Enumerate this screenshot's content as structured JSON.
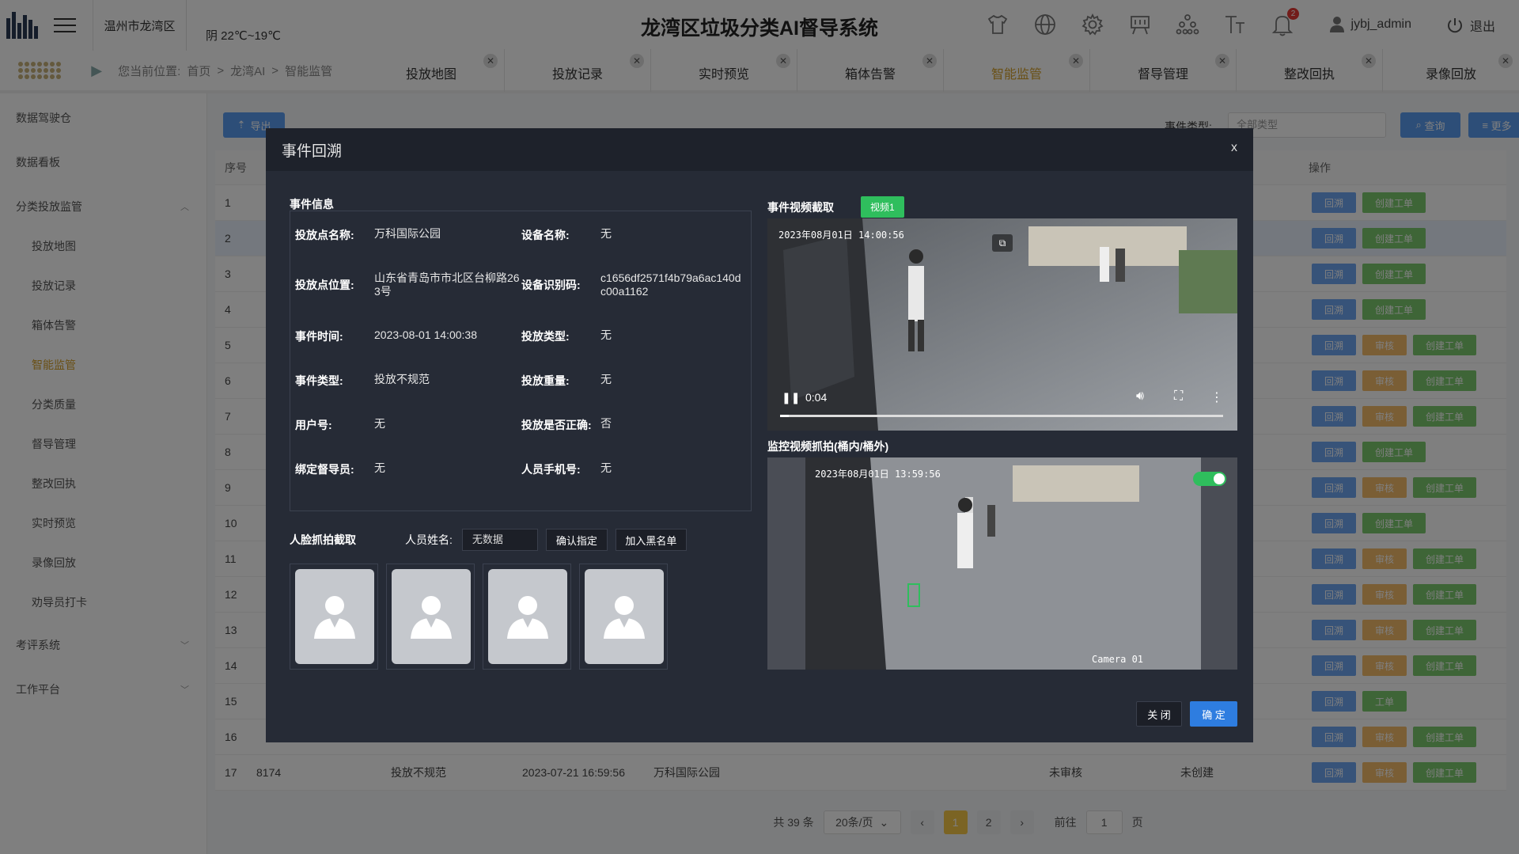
{
  "header": {
    "city": "温州市龙湾区",
    "weather": "阴 22℃~19℃",
    "title": "龙湾区垃圾分类AI督导系统",
    "icons": [
      "shirt-icon",
      "globe-icon",
      "gear-icon",
      "board-icon",
      "org-icon",
      "font-size-icon",
      "bell-icon"
    ],
    "bell_count": "2",
    "username": "jybj_admin",
    "logout": "退出"
  },
  "breadcrumb": {
    "prefix": "您当前位置:",
    "items": [
      "首页",
      "龙湾AI",
      "智能监管"
    ]
  },
  "tabs": [
    {
      "label": "投放地图"
    },
    {
      "label": "投放记录"
    },
    {
      "label": "实时预览"
    },
    {
      "label": "箱体告警"
    },
    {
      "label": "智能监管"
    },
    {
      "label": "督导管理"
    },
    {
      "label": "整改回执"
    },
    {
      "label": "录像回放"
    }
  ],
  "sidebar": {
    "top": [
      {
        "label": "数据驾驶仓"
      },
      {
        "label": "数据看板"
      }
    ],
    "group1": {
      "label": "分类投放监管"
    },
    "sub": [
      {
        "label": "投放地图"
      },
      {
        "label": "投放记录"
      },
      {
        "label": "箱体告警"
      },
      {
        "label": "智能监管"
      },
      {
        "label": "分类质量"
      },
      {
        "label": "督导管理"
      },
      {
        "label": "整改回执"
      },
      {
        "label": "实时预览"
      },
      {
        "label": "录像回放"
      },
      {
        "label": "劝导员打卡"
      }
    ],
    "group2": {
      "label": "考评系统"
    },
    "group3": {
      "label": "工作平台"
    }
  },
  "toolbar": {
    "export": "导出",
    "filter_label": "事件类型:",
    "filter_value": "全部类型",
    "query": "查询",
    "more": "更多"
  },
  "table": {
    "header_index": "序号",
    "header_ops": "操作",
    "rows": [
      {
        "idx": "1",
        "ops": [
          "回溯",
          "创建工单"
        ]
      },
      {
        "idx": "2",
        "ops": [
          "回溯",
          "创建工单"
        ]
      },
      {
        "idx": "3",
        "ops": [
          "回溯",
          "创建工单"
        ]
      },
      {
        "idx": "4",
        "ops": [
          "回溯",
          "创建工单"
        ]
      },
      {
        "idx": "5",
        "ops": [
          "回溯",
          "审核",
          "创建工单"
        ]
      },
      {
        "idx": "6",
        "ops": [
          "回溯",
          "审核",
          "创建工单"
        ]
      },
      {
        "idx": "7",
        "ops": [
          "回溯",
          "审核",
          "创建工单"
        ]
      },
      {
        "idx": "8",
        "ops": [
          "回溯",
          "创建工单"
        ]
      },
      {
        "idx": "9",
        "ops": [
          "回溯",
          "审核",
          "创建工单"
        ]
      },
      {
        "idx": "10",
        "ops": [
          "回溯",
          "创建工单"
        ]
      },
      {
        "idx": "11",
        "ops": [
          "回溯",
          "审核",
          "创建工单"
        ]
      },
      {
        "idx": "12",
        "ops": [
          "回溯",
          "审核",
          "创建工单"
        ]
      },
      {
        "idx": "13",
        "ops": [
          "回溯",
          "审核",
          "创建工单"
        ]
      },
      {
        "idx": "14",
        "ops": [
          "回溯",
          "审核",
          "创建工单"
        ]
      },
      {
        "idx": "15",
        "ops": [
          "回溯",
          "工单"
        ]
      },
      {
        "idx": "16",
        "ops": [
          "回溯",
          "审核",
          "创建工单"
        ]
      },
      {
        "idx": "17",
        "id": "8174",
        "type": "投放不规范",
        "time": "2023-07-21 16:59:56",
        "place": "万科国际公园",
        "audit": "未审核",
        "order": "未创建",
        "ops": [
          "回溯",
          "审核",
          "创建工单"
        ]
      }
    ]
  },
  "pager": {
    "total": "共 39 条",
    "size": "20条/页",
    "pages": [
      "1",
      "2"
    ],
    "goto_prefix": "前往",
    "goto_value": "1",
    "goto_suffix": "页"
  },
  "modal": {
    "title": "事件回溯",
    "close": "x",
    "info_title": "事件信息",
    "fields": {
      "place_name_k": "投放点名称:",
      "place_name_v": "万科国际公园",
      "device_name_k": "设备名称:",
      "device_name_v": "无",
      "place_loc_k": "投放点位置:",
      "place_loc_v": "山东省青岛市市北区台柳路263号",
      "device_id_k": "设备识别码:",
      "device_id_v": "c1656df2571f4b79a6ac140dc00a1162",
      "event_time_k": "事件时间:",
      "event_time_v": "2023-08-01 14:00:38",
      "drop_type_k": "投放类型:",
      "drop_type_v": "无",
      "event_type_k": "事件类型:",
      "event_type_v": "投放不规范",
      "weight_k": "投放重量:",
      "weight_v": "无",
      "user_no_k": "用户号:",
      "user_no_v": "无",
      "correct_k": "投放是否正确:",
      "correct_v": "否",
      "supervisor_k": "绑定督导员:",
      "supervisor_v": "无",
      "phone_k": "人员手机号:",
      "phone_v": "无"
    },
    "face_title": "人脸抓拍截取",
    "face_name_label": "人员姓名:",
    "face_name_value": "无数据",
    "confirm_btn": "确认指定",
    "blacklist_btn": "加入黑名单",
    "video_title": "事件视频截取",
    "video_tag": "视频1",
    "video_ts": "2023年08月01日  14:00:56",
    "video_time": "0:04",
    "video_progress": 0.02,
    "monitor_title": "监控视频抓拍(桶内/桶外)",
    "monitor_ts": "2023年08月01日  13:59:56",
    "camera_label": "Camera 01",
    "cancel": "关 闭",
    "ok": "确 定"
  }
}
